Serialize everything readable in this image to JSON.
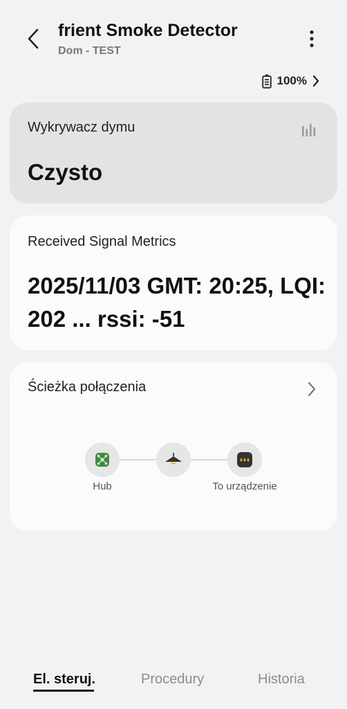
{
  "header": {
    "title": "frient Smoke Detector",
    "subtitle": "Dom - TEST",
    "battery": "100%"
  },
  "smoke_card": {
    "label": "Wykrywacz dymu",
    "value": "Czysto"
  },
  "signal_card": {
    "label": "Received Signal Metrics",
    "value": "2025/11/03 GMT: 20:25, LQI: 202 ... rssi: -51"
  },
  "path_card": {
    "label": "Ścieżka połączenia",
    "nodes": [
      {
        "label": "Hub"
      },
      {
        "label": ""
      },
      {
        "label": "To urządzenie"
      }
    ]
  },
  "tabs": [
    {
      "label": "El. steruj.",
      "active": true
    },
    {
      "label": "Procedury",
      "active": false
    },
    {
      "label": "Historia",
      "active": false
    }
  ],
  "colors": {
    "background": "#f2f2f4",
    "active_card": "#e3e3e5",
    "card": "#fbfbfc",
    "hub_green": "#3b8e3b",
    "device_yellow": "#f0c020"
  }
}
